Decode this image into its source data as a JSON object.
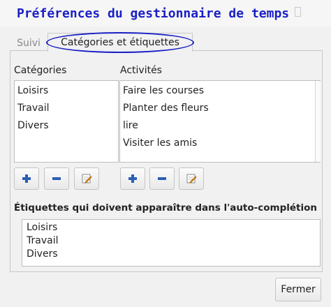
{
  "window": {
    "title": "Préférences du gestionnaire de temps"
  },
  "tabs": [
    {
      "label": "Suivi",
      "active": false
    },
    {
      "label": "Catégories et étiquettes",
      "active": true
    }
  ],
  "categories": {
    "header": "Catégories",
    "items": [
      "Loisirs",
      "Travail",
      "Divers"
    ]
  },
  "activities": {
    "header": "Activités",
    "items": [
      "Faire les courses",
      "Planter des fleurs",
      "lire",
      "Visiter les amis"
    ]
  },
  "toolbar_icons": {
    "add": "plus-icon",
    "remove": "minus-icon",
    "edit": "edit-icon"
  },
  "autocompletion": {
    "header": "Étiquettes qui doivent apparaître dans l'auto-complétion",
    "items": [
      "Loisirs",
      "Travail",
      "Divers"
    ]
  },
  "footer": {
    "close_label": "Fermer"
  },
  "colors": {
    "annotation": "#1a1fc4",
    "icon_blue": "#2a5fb4",
    "icon_red": "#b22"
  }
}
